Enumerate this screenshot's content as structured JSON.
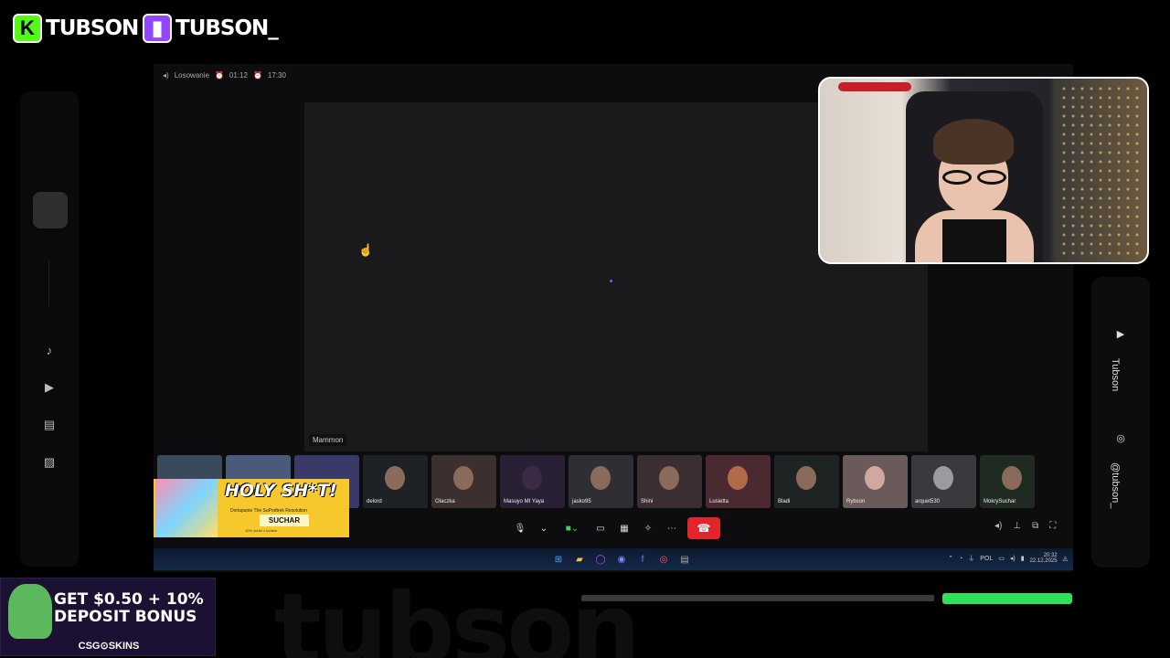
{
  "overlay": {
    "kick_name": "TUBSON",
    "twitch_name": "TUBSON_",
    "background_word": "tubson"
  },
  "window": {
    "title_line": "Losowanie",
    "time_a": "01:12",
    "time_b": "17:30"
  },
  "stage": {
    "speaker_label": "Mammon"
  },
  "participants": [
    {
      "name": ""
    },
    {
      "name": ""
    },
    {
      "name": ""
    },
    {
      "name": "delord"
    },
    {
      "name": "Olaczka"
    },
    {
      "name": "Masuyo MI Yaya"
    },
    {
      "name": "jasko95"
    },
    {
      "name": "Shini"
    },
    {
      "name": "Lusietta"
    },
    {
      "name": "Bladi"
    },
    {
      "name": "Rybson"
    },
    {
      "name": "arquet530"
    },
    {
      "name": "MokrySuchar"
    }
  ],
  "promo": {
    "headline": "HOLY SH*T!",
    "subline": "Dorlapanie The SuPodtrek Resolution",
    "code": "SUCHAR",
    "footer": "10% zniżki z kodem"
  },
  "taskbar": {
    "lang": "POL",
    "time": "20:32",
    "date": "22.12.2025"
  },
  "socials": {
    "youtube_handle": "Tubson",
    "instagram_handle": "@tubson_"
  },
  "sponsor": {
    "offer_line1": "GET $0.50 + 10%",
    "offer_line2": "DEPOSIT BONUS",
    "brand": "CSG⊙SKINS"
  },
  "colors": {
    "kick": "#53fc18",
    "twitch": "#9146ff",
    "end_call": "#e0262a",
    "promo_yellow": "#f6c82c"
  }
}
